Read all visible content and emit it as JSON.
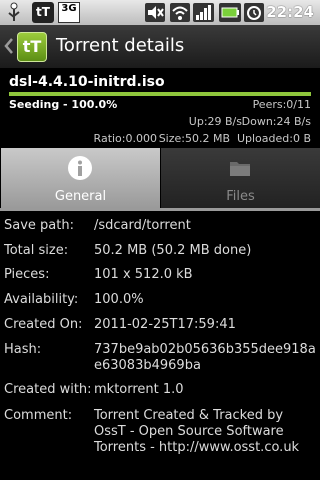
{
  "status_bar": {
    "icons": [
      "usb-icon",
      "ttorrent-notification-icon",
      "3g-icon",
      "muted-icon",
      "wifi-icon",
      "signal-icon",
      "battery-icon",
      "alarm-icon"
    ],
    "network": "3G",
    "app_badge": "tT",
    "time": "22:24"
  },
  "header": {
    "logo_text": "tT",
    "title": "Torrent details"
  },
  "torrent": {
    "name": "dsl-4.4.10-initrd.iso",
    "progress": 1.0,
    "status": "Seeding - 100.0%",
    "peers": "Peers:0/11",
    "up": "Up:29 B/s",
    "down": "Down:24 B/s",
    "ratio": "Ratio:0.000",
    "size": "Size:50.2 MB",
    "uploaded": "Uploaded:0 B"
  },
  "tabs": [
    {
      "label": "General",
      "icon": "info-icon",
      "selected": true
    },
    {
      "label": "Files",
      "icon": "folder-icon",
      "selected": false
    }
  ],
  "details": [
    {
      "key": "Save path:",
      "value": "/sdcard/torrent"
    },
    {
      "key": "Total size:",
      "value": "50.2 MB (50.2 MB done)"
    },
    {
      "key": "Pieces:",
      "value": "101 x 512.0 kB"
    },
    {
      "key": "Availability:",
      "value": "100.0%"
    },
    {
      "key": "Created On:",
      "value": "2011-02-25T17:59:41"
    },
    {
      "key": "Hash:",
      "value": "737be9ab02b05636b355dee918ae63083b4969ba"
    },
    {
      "key": "Created with:",
      "value": "mktorrent 1.0"
    },
    {
      "key": "Comment:",
      "value": "Torrent Created & Tracked by OssT - Open Source Software Torrents - http://www.osst.co.uk"
    }
  ],
  "colors": {
    "accent": "#8fc63c",
    "tab_selected": "#b0b0b0"
  }
}
